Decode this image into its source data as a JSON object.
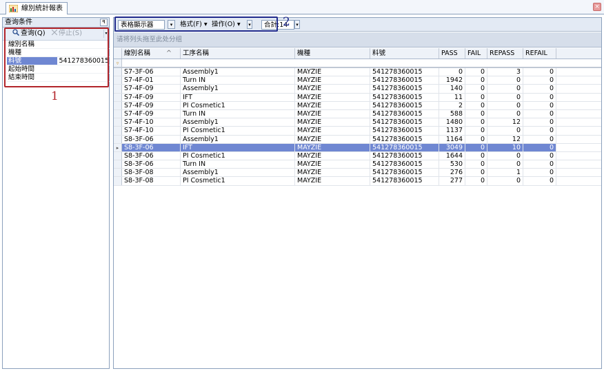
{
  "window": {
    "tab_title": "線別統計報表",
    "close_glyph": "×"
  },
  "left_panel": {
    "header": "查询条件",
    "pin_glyph": "ꟼ",
    "query_label": "查询(Q)",
    "stop_label": "停止(S)",
    "conditions": [
      {
        "key": "線別名稱",
        "value": ""
      },
      {
        "key": "機種",
        "value": ""
      },
      {
        "key": "料號",
        "value": "541278360015"
      },
      {
        "key": "起始時間",
        "value": ""
      },
      {
        "key": "結束時間",
        "value": ""
      }
    ],
    "selected_index": 2,
    "annotation": "1"
  },
  "toolbar": {
    "display_combo": "表格顯示器",
    "format_label": "格式(F)",
    "operate_label": "操作(O)",
    "total_label": "合計:14",
    "annotation": "2"
  },
  "group_panel_hint": "请将列头拖至此处分组",
  "grid": {
    "columns": [
      "線別名稱",
      "工序名稱",
      "機種",
      "料號",
      "PASS",
      "FAIL",
      "REPASS",
      "REFAIL"
    ],
    "sort_glyph": "^",
    "filter_glyph": "▿",
    "current_row_glyph": "▸",
    "rows": [
      [
        "S7-3F-06",
        "Assembly1",
        "MAYZIE",
        "541278360015",
        "0",
        "0",
        "3",
        "0"
      ],
      [
        "S7-4F-01",
        "Turn IN",
        "MAYZIE",
        "541278360015",
        "1942",
        "0",
        "0",
        "0"
      ],
      [
        "S7-4F-09",
        "Assembly1",
        "MAYZIE",
        "541278360015",
        "140",
        "0",
        "0",
        "0"
      ],
      [
        "S7-4F-09",
        "IFT",
        "MAYZIE",
        "541278360015",
        "11",
        "0",
        "0",
        "0"
      ],
      [
        "S7-4F-09",
        "PI Cosmetic1",
        "MAYZIE",
        "541278360015",
        "2",
        "0",
        "0",
        "0"
      ],
      [
        "S7-4F-09",
        "Turn IN",
        "MAYZIE",
        "541278360015",
        "588",
        "0",
        "0",
        "0"
      ],
      [
        "S7-4F-10",
        "Assembly1",
        "MAYZIE",
        "541278360015",
        "1480",
        "0",
        "12",
        "0"
      ],
      [
        "S7-4F-10",
        "PI Cosmetic1",
        "MAYZIE",
        "541278360015",
        "1137",
        "0",
        "0",
        "0"
      ],
      [
        "S8-3F-06",
        "Assembly1",
        "MAYZIE",
        "541278360015",
        "1164",
        "0",
        "12",
        "0"
      ],
      [
        "S8-3F-06",
        "IFT",
        "MAYZIE",
        "541278360015",
        "3049",
        "0",
        "10",
        "0"
      ],
      [
        "S8-3F-06",
        "PI Cosmetic1",
        "MAYZIE",
        "541278360015",
        "1644",
        "0",
        "0",
        "0"
      ],
      [
        "S8-3F-06",
        "Turn IN",
        "MAYZIE",
        "541278360015",
        "530",
        "0",
        "0",
        "0"
      ],
      [
        "S8-3F-08",
        "Assembly1",
        "MAYZIE",
        "541278360015",
        "276",
        "0",
        "1",
        "0"
      ],
      [
        "S8-3F-08",
        "PI Cosmetic1",
        "MAYZIE",
        "541278360015",
        "277",
        "0",
        "0",
        "0"
      ]
    ],
    "selected_row": 9
  },
  "colors": {
    "selection": "#6f87d2",
    "annotation_red": "#b2242a",
    "annotation_blue": "#1f2a8c"
  }
}
